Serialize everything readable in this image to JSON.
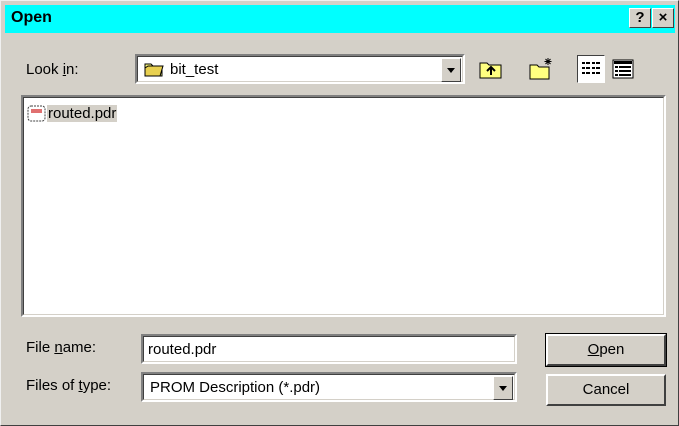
{
  "window": {
    "title": "Open",
    "help_label": "?",
    "close_label": "×"
  },
  "look_in": {
    "label_pre": "Look ",
    "label_key": "i",
    "label_post": "n:",
    "value": "bit_test",
    "folder_icon": "folder-icon"
  },
  "toolbar": {
    "up_icon": "up-one-level-icon",
    "new_folder_icon": "new-folder-icon",
    "list_icon": "list-view-icon",
    "details_icon": "details-view-icon"
  },
  "files": [
    {
      "name": "routed.pdr",
      "icon": "pdr-file-icon"
    }
  ],
  "file_name": {
    "label_pre": "File ",
    "label_key": "n",
    "label_post": "ame:",
    "value": "routed.pdr"
  },
  "file_type": {
    "label_pre": "Files of ",
    "label_key": "t",
    "label_post": "ype:",
    "value": "PROM Description (*.pdr)"
  },
  "buttons": {
    "open_key": "O",
    "open_rest": "pen",
    "cancel": "Cancel"
  }
}
